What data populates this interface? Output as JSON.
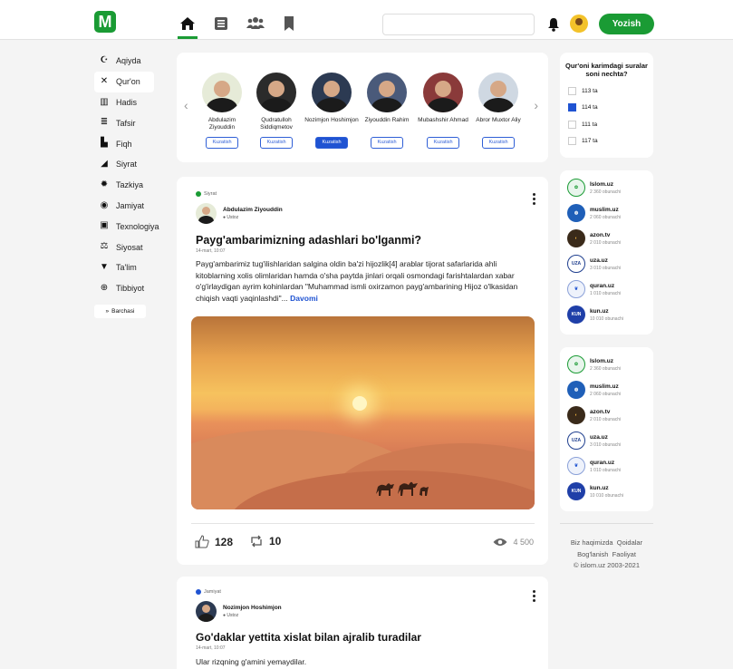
{
  "header": {
    "logo_text": "M",
    "nav_icons": [
      "home-icon",
      "news-icon",
      "people-icon",
      "bookmark-icon"
    ],
    "search_placeholder": "",
    "cta_label": "Yozish",
    "accent_color": "#1a9b34"
  },
  "sidebar": {
    "items": [
      {
        "label": "Aqiyda",
        "icon": "crescent-icon"
      },
      {
        "label": "Qur'on",
        "icon": "quran-stand-icon"
      },
      {
        "label": "Hadis",
        "icon": "open-book-icon"
      },
      {
        "label": "Tafsir",
        "icon": "books-icon"
      },
      {
        "label": "Fiqh",
        "icon": "library-icon"
      },
      {
        "label": "Siyrat",
        "icon": "chart-icon"
      },
      {
        "label": "Tazkiya",
        "icon": "sun-icon"
      },
      {
        "label": "Jamiyat",
        "icon": "globe-icon"
      },
      {
        "label": "Texnologiya",
        "icon": "chip-icon"
      },
      {
        "label": "Siyosat",
        "icon": "scales-icon"
      },
      {
        "label": "Ta'lim",
        "icon": "graduation-cap-icon"
      },
      {
        "label": "Tibbiyot",
        "icon": "medical-plus-icon"
      }
    ],
    "more_label": "Barchasi"
  },
  "scholars": [
    {
      "name": "Abdulazim Ziyouddin",
      "follow": "Kuzatish",
      "following": false
    },
    {
      "name": "Qudratulloh Siddiqmetov",
      "follow": "Kuzatish",
      "following": false
    },
    {
      "name": "Nozimjon Hoshimjon",
      "follow": "Kuzatish",
      "following": true
    },
    {
      "name": "Ziyouddin Rahim",
      "follow": "Kuzatish",
      "following": false
    },
    {
      "name": "Mubashshir Ahmad",
      "follow": "Kuzatish",
      "following": false
    },
    {
      "name": "Abror Muxtor Aliy",
      "follow": "Kuzatish",
      "following": false
    }
  ],
  "quiz": {
    "title": "Qur'oni karimdagi suralar soni nechta?",
    "options": [
      {
        "label": "113 ta",
        "selected": false
      },
      {
        "label": "114 ta",
        "selected": true
      },
      {
        "label": "111 ta",
        "selected": false
      },
      {
        "label": "117 ta",
        "selected": false
      }
    ]
  },
  "sources": [
    {
      "name": "Islom.uz",
      "subs": "2 360 obunachi",
      "logo": "",
      "color": "#e8f5ec",
      "fg": "#1a9b34"
    },
    {
      "name": "muslim.uz",
      "subs": "2 060 obunachi",
      "logo": "",
      "color": "#1f5fb8",
      "fg": "#fff"
    },
    {
      "name": "azon.tv",
      "subs": "2 010 obunachi",
      "logo": "",
      "color": "#3a2a1a",
      "fg": "#f2b33d"
    },
    {
      "name": "uza.uz",
      "subs": "3 010 obunachi",
      "logo": "UZA",
      "color": "#fff",
      "fg": "#1f3f8f"
    },
    {
      "name": "quran.uz",
      "subs": "1 010 obunachi",
      "logo": "",
      "color": "#eef2fb",
      "fg": "#1f53d2"
    },
    {
      "name": "kun.uz",
      "subs": "10 010 obunachi",
      "logo": "KUN",
      "color": "#1f3fa8",
      "fg": "#fff"
    }
  ],
  "footer": {
    "line1_a": "Biz haqimizda",
    "line1_b": "Qoidalar",
    "line2_a": "Bog'lanish",
    "line2_b": "Faoliyat",
    "copyright": "© islom.uz 2003-2021"
  },
  "posts": [
    {
      "category": "Siyrat",
      "category_color": "#1a9b34",
      "author": "Abdulazim Ziyouddin",
      "role": "Ustoz",
      "title": "Payg'ambarimizning adashlari bo'lganmi?",
      "date": "14-mart, 10:07",
      "body": "Payg'ambarimiz tug'ilishlaridan salgina oldin ba'zi hijozlik[4] arablar tijorat safarlarida ahli kitoblarning xolis olimlaridan hamda o'sha paytda jinlari orqali osmondagi farishtalardan xabar o'g'irlaydigan ayrim kohinlardan \"Muhammad ismli oxirzamon payg'ambarining Hijoz o'lkasidan chiqish vaqti yaqinlashdi\"...",
      "more": "Davomi",
      "likes": "128",
      "reposts": "10",
      "views": "4 500"
    },
    {
      "category": "Jamiyat",
      "category_color": "#1f53d2",
      "author": "Nozimjon Hoshimjon",
      "role": "Ustoz",
      "title": "Go'daklar yettita xislat bilan ajralib turadilar",
      "date": "14-mart, 10:07",
      "body": "Ular rizqning g'amini yemaydilar."
    }
  ]
}
